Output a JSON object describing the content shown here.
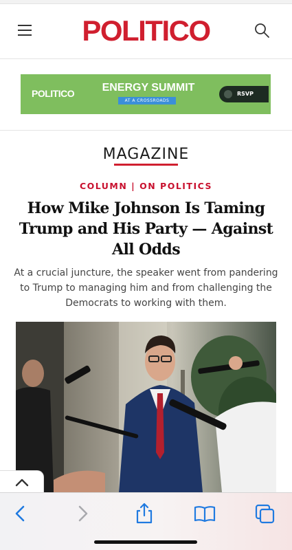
{
  "header": {
    "logo": "POLITICO",
    "menu_icon": "hamburger-menu-icon",
    "search_icon": "search-icon",
    "brand_color": "#d01f2f"
  },
  "ad": {
    "brand": "POLITICO",
    "title": "ENERGY SUMMIT",
    "subtitle": "AT A CROSSROADS",
    "cta": "RSVP",
    "background": "#7fbe5e"
  },
  "article": {
    "section": "MAGAZINE",
    "kicker": "COLUMN | ON POLITICS",
    "headline": "How Mike Johnson Is Taming Trump and His Party — Against All Odds",
    "dek": "At a crucial juncture, the speaker went from pandering to Trump to managing him and from challenging the Democrats to working with them.",
    "image": "photo of Mike Johnson speaking to reporters holding microphones"
  },
  "browser": {
    "scroll_up_icon": "chevron-up-icon",
    "toolbar": [
      "back-icon",
      "forward-icon",
      "share-icon",
      "bookmarks-icon",
      "tabs-icon"
    ],
    "accent": "#1f7ae0"
  }
}
